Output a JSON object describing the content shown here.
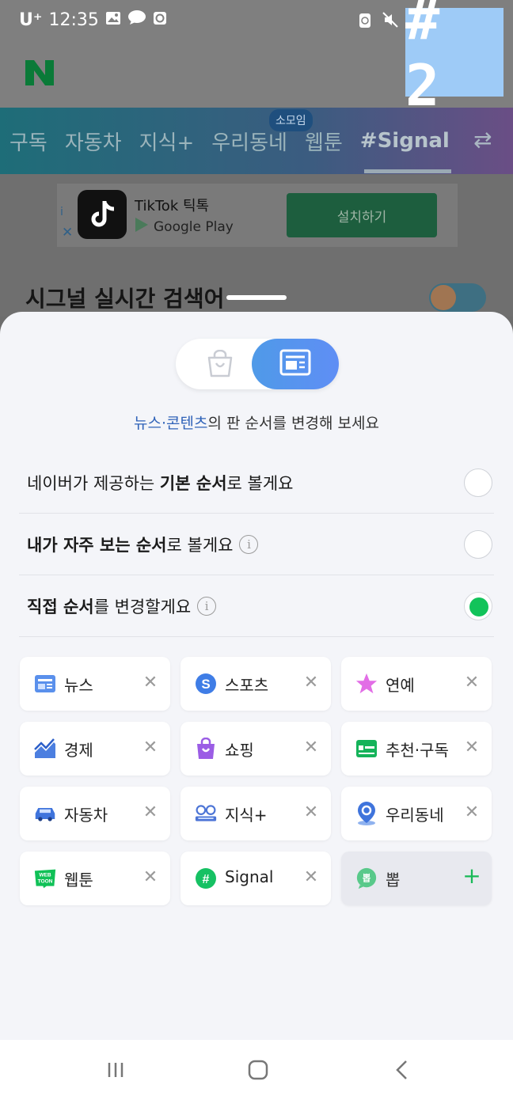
{
  "status": {
    "carrier": "U⁺",
    "time": "12:35",
    "left_icons": [
      "gallery-icon",
      "chat-bubble-icon",
      "clock-app-icon"
    ],
    "right_icons": [
      "recycle-icon",
      "mute-icon",
      "wifi-icon"
    ]
  },
  "overlay_badge": "# 2",
  "header": {
    "logo": "N"
  },
  "tabs": {
    "items": [
      "구독",
      "자동차",
      "지식+",
      "우리동네",
      "웹툰",
      "#Signal"
    ],
    "active": "#Signal",
    "somoim_badge": "소모임",
    "swap_icon": "⇄"
  },
  "ad": {
    "app_name": "TikTok 틱톡",
    "store": "Google Play",
    "cta": "설치하기",
    "info": "i",
    "close": "✕"
  },
  "realtime": {
    "title": "시그널 실시간 검색어"
  },
  "sheet": {
    "caption_highlight": "뉴스·콘텐츠",
    "caption_rest": "의 판 순서를 변경해 보세요",
    "options": [
      {
        "pre": "네이버가 제공하는 ",
        "bold": "기본 순서",
        "post": "로 볼게요",
        "info": false,
        "checked": false
      },
      {
        "pre": "",
        "bold": "내가 자주 보는 순서",
        "post": "로 볼게요",
        "info": true,
        "checked": false
      },
      {
        "pre": "",
        "bold": "직접 순서",
        "post": "를 변경할게요",
        "info": true,
        "checked": true
      }
    ],
    "info_glyph": "i",
    "chips": [
      {
        "label": "뉴스",
        "icon": "news-icon",
        "action": "✕",
        "active": true
      },
      {
        "label": "스포츠",
        "icon": "sports-icon",
        "action": "✕",
        "active": true
      },
      {
        "label": "연예",
        "icon": "star-icon",
        "action": "✕",
        "active": true
      },
      {
        "label": "경제",
        "icon": "economy-chart-icon",
        "action": "✕",
        "active": true
      },
      {
        "label": "쇼핑",
        "icon": "shopping-bag-icon",
        "action": "✕",
        "active": true
      },
      {
        "label": "추천·구독",
        "icon": "subscribe-card-icon",
        "action": "✕",
        "active": true
      },
      {
        "label": "자동차",
        "icon": "car-icon",
        "action": "✕",
        "active": true
      },
      {
        "label": "지식+",
        "icon": "knowledge-glasses-icon",
        "action": "✕",
        "active": true
      },
      {
        "label": "우리동네",
        "icon": "location-pin-icon",
        "action": "✕",
        "active": true
      },
      {
        "label": "웹툰",
        "icon": "webtoon-icon",
        "action": "✕",
        "active": true
      },
      {
        "label": "Signal",
        "icon": "signal-hash-icon",
        "action": "✕",
        "active": true
      },
      {
        "label": "뽑",
        "icon": "ppum-icon",
        "action": "+",
        "active": false
      }
    ],
    "icon_texts": {
      "sports": "S",
      "signal": "#",
      "webtoon_top": "WEB",
      "webtoon_bottom": "TOON",
      "ppum": "뽑"
    }
  },
  "nav": {
    "recents": "|||",
    "home": "▢",
    "back": "❮"
  },
  "colors": {
    "accent_blue": "#5b93f0",
    "accent_green": "#12c35a",
    "caption_link": "#2f62b8",
    "naver_green": "#03c75a"
  }
}
